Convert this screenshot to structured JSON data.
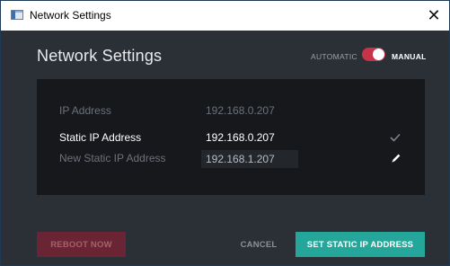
{
  "window": {
    "title": "Network Settings",
    "close_glyph": "✕",
    "app_icon": "window-app-icon"
  },
  "header": {
    "title": "Network Settings",
    "mode_automatic": "AUTOMATIC",
    "mode_manual": "MANUAL",
    "mode_selected": "MANUAL",
    "toggle_color": "#c73348"
  },
  "fields": {
    "ip_address": {
      "label": "IP Address",
      "value": "192.168.0.207"
    },
    "static_ip": {
      "label": "Static IP Address",
      "value": "192.168.0.207",
      "icon": "check-icon"
    },
    "new_static_ip": {
      "label": "New Static IP Address",
      "value": "192.168.1.207",
      "icon": "pencil-icon"
    }
  },
  "actions": {
    "reboot": "REBOOT NOW",
    "cancel": "CANCEL",
    "set_static": "SET STATIC IP ADDRESS",
    "accent_color": "#24a79a"
  }
}
